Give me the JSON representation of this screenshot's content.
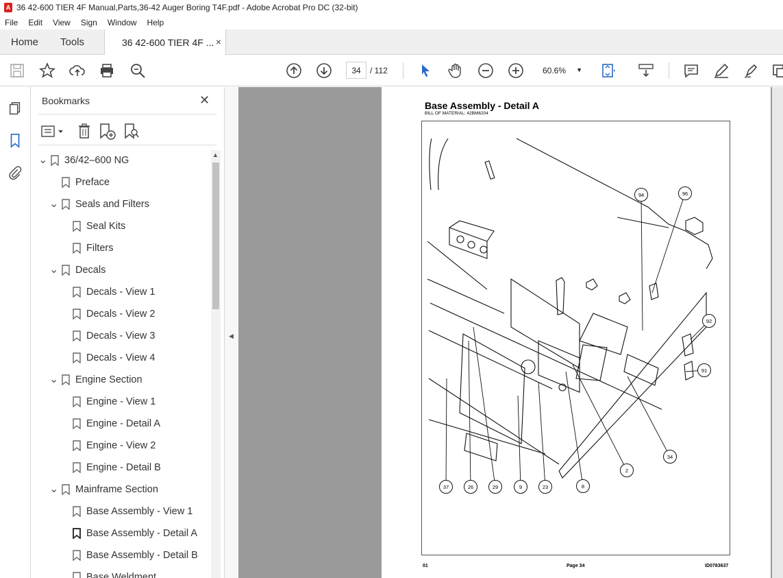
{
  "window": {
    "title": "36 42-600 TIER 4F Manual,Parts,36-42 Auger Boring T4F.pdf - Adobe Acrobat Pro DC (32-bit)"
  },
  "menu": [
    "File",
    "Edit",
    "View",
    "Sign",
    "Window",
    "Help"
  ],
  "tabs": {
    "home": "Home",
    "tools": "Tools",
    "document": "36 42-600 TIER 4F ...",
    "close": "×"
  },
  "toolbar": {
    "page_current": "34",
    "page_total": "/ 112",
    "zoom": "60.6%"
  },
  "bookmarks": {
    "title": "Bookmarks",
    "close": "✕",
    "items": [
      {
        "label": "36/42–600 NG",
        "level": 0,
        "expanded": true
      },
      {
        "label": "Preface",
        "level": 1,
        "expanded": null
      },
      {
        "label": "Seals and Filters",
        "level": 1,
        "expanded": true
      },
      {
        "label": "Seal Kits",
        "level": 2,
        "expanded": null
      },
      {
        "label": "Filters",
        "level": 2,
        "expanded": null
      },
      {
        "label": "Decals",
        "level": 1,
        "expanded": true
      },
      {
        "label": "Decals - View 1",
        "level": 2,
        "expanded": null
      },
      {
        "label": "Decals - View 2",
        "level": 2,
        "expanded": null
      },
      {
        "label": "Decals - View 3",
        "level": 2,
        "expanded": null
      },
      {
        "label": "Decals - View 4",
        "level": 2,
        "expanded": null
      },
      {
        "label": "Engine Section",
        "level": 1,
        "expanded": true
      },
      {
        "label": "Engine - View 1",
        "level": 2,
        "expanded": null
      },
      {
        "label": "Engine - Detail A",
        "level": 2,
        "expanded": null
      },
      {
        "label": "Engine - View 2",
        "level": 2,
        "expanded": null
      },
      {
        "label": "Engine - Detail B",
        "level": 2,
        "expanded": null
      },
      {
        "label": "Mainframe Section",
        "level": 1,
        "expanded": true
      },
      {
        "label": "Base Assembly - View 1",
        "level": 2,
        "expanded": null
      },
      {
        "label": "Base Assembly - Detail A",
        "level": 2,
        "expanded": null,
        "current": true
      },
      {
        "label": "Base Assembly - Detail B",
        "level": 2,
        "expanded": null
      },
      {
        "label": "Base Weldment",
        "level": 2,
        "expanded": null
      }
    ]
  },
  "document_page": {
    "title": "Base Assembly - Detail A",
    "subtitle": "BILL OF MATERIAL: 42BM6204",
    "footer_left": "01",
    "footer_center": "Page 34",
    "footer_right": "ID0783637",
    "callouts": [
      "94",
      "96",
      "92",
      "91",
      "34",
      "2",
      "8",
      "23",
      "9",
      "29",
      "26",
      "37"
    ]
  }
}
